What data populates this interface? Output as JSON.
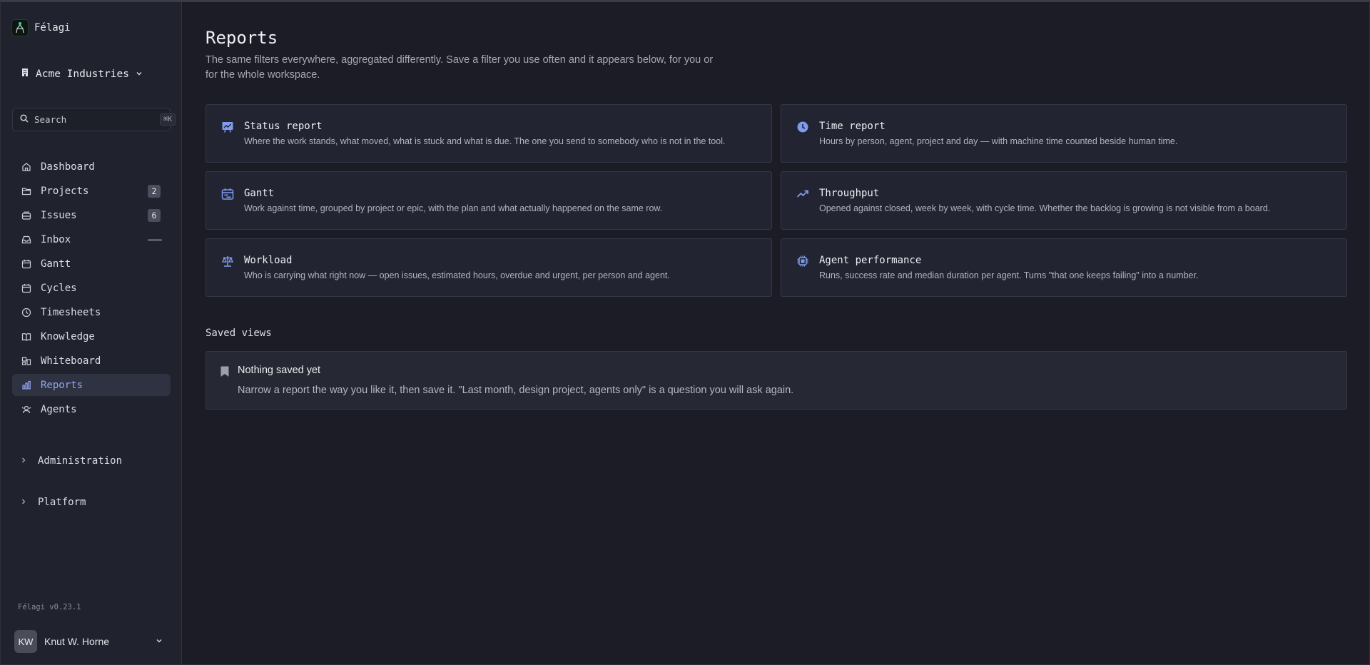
{
  "app": {
    "name": "Félagi",
    "version": "Félagi v0.23.1"
  },
  "workspace": {
    "name": "Acme Industries"
  },
  "search": {
    "placeholder": "Search",
    "shortcut": "⌘K"
  },
  "sidebar": {
    "items": [
      {
        "label": "Dashboard",
        "icon": "home-icon"
      },
      {
        "label": "Projects",
        "icon": "folder-icon",
        "badge": "2"
      },
      {
        "label": "Issues",
        "icon": "stack-icon",
        "badge": "6"
      },
      {
        "label": "Inbox",
        "icon": "inbox-icon"
      },
      {
        "label": "Gantt",
        "icon": "calendar-icon"
      },
      {
        "label": "Cycles",
        "icon": "calendar-icon"
      },
      {
        "label": "Timesheets",
        "icon": "clock-icon"
      },
      {
        "label": "Knowledge",
        "icon": "book-icon"
      },
      {
        "label": "Whiteboard",
        "icon": "whiteboard-icon"
      },
      {
        "label": "Reports",
        "icon": "bar-chart-icon",
        "active": true
      },
      {
        "label": "Agents",
        "icon": "agents-icon"
      }
    ],
    "sections": [
      {
        "label": "Administration"
      },
      {
        "label": "Platform"
      }
    ]
  },
  "user": {
    "initials": "KW",
    "name": "Knut W. Horne"
  },
  "main": {
    "title": "Reports",
    "subtitle": "The same filters everywhere, aggregated differently. Save a filter you use often and it appears below, for you or for the whole workspace.",
    "reports": [
      {
        "title": "Status report",
        "desc": "Where the work stands, what moved, what is stuck and what is due. The one you send to somebody who is not in the tool.",
        "icon": "presentation-chart-icon"
      },
      {
        "title": "Time report",
        "desc": "Hours by person, agent, project and day — with machine time counted beside human time.",
        "icon": "clock-icon"
      },
      {
        "title": "Gantt",
        "desc": "Work against time, grouped by project or epic, with the plan and what actually happened on the same row.",
        "icon": "calendar-icon"
      },
      {
        "title": "Throughput",
        "desc": "Opened against closed, week by week, with cycle time. Whether the backlog is growing is not visible from a board.",
        "icon": "trending-up-icon"
      },
      {
        "title": "Workload",
        "desc": "Who is carrying what right now — open issues, estimated hours, overdue and urgent, per person and agent.",
        "icon": "scale-icon"
      },
      {
        "title": "Agent performance",
        "desc": "Runs, success rate and median duration per agent. Turns \"that one keeps failing\" into a number.",
        "icon": "chip-icon"
      }
    ],
    "saved": {
      "label": "Saved views",
      "empty_title": "Nothing saved yet",
      "empty_desc": "Narrow a report the way you like it, then save it. \"Last month, design project, agents only\" is a question you will ask again."
    }
  },
  "colors": {
    "accent": "#8fa8f5",
    "icon_blue": "#7f9bf0",
    "background": "#1b1c26",
    "sidebar": "#20222d"
  }
}
